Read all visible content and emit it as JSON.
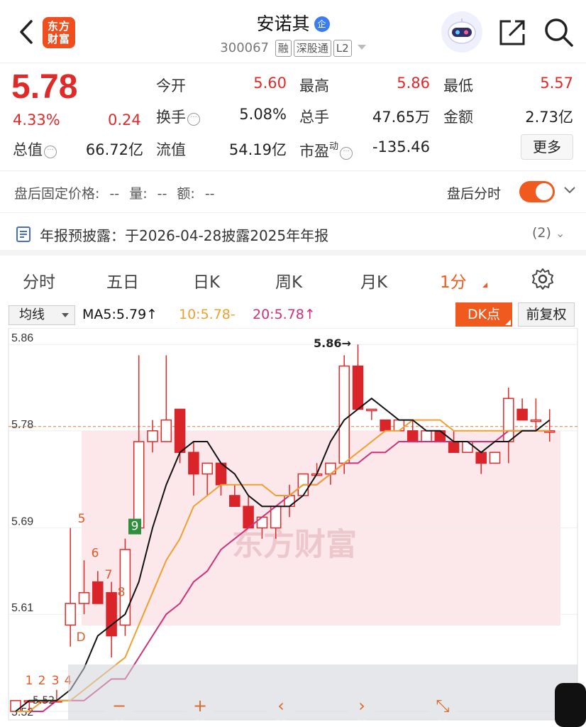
{
  "header": {
    "back_icon": "chevron-left-icon",
    "logo_text": "东方\n财富",
    "stock_name": "安诺其",
    "verified_badge": "企",
    "code": "300067",
    "tags": [
      "融",
      "深股通",
      "L2"
    ],
    "robot_icon": "robot-icon",
    "share_icon": "share-icon",
    "search_icon": "search-icon"
  },
  "quote": {
    "price": "5.78",
    "change_pct": "4.33%",
    "change": "0.24",
    "rows": [
      [
        {
          "label": "今开",
          "value": "5.60",
          "color": "red"
        },
        {
          "label": "最高",
          "value": "5.86",
          "color": "red"
        },
        {
          "label": "最低",
          "value": "5.57",
          "color": "red"
        }
      ],
      [
        {
          "label": "换手",
          "value": "5.08%",
          "color": "dark"
        },
        {
          "label": "总手",
          "value": "47.65万",
          "color": "dark"
        },
        {
          "label": "金额",
          "value": "2.73亿",
          "color": "dark"
        }
      ],
      [
        {
          "label": "流值",
          "value": "54.19亿",
          "color": "dark"
        },
        {
          "label": "市盈",
          "value": "-135.46",
          "color": "dark"
        }
      ]
    ],
    "total_value_label": "总值",
    "total_value": "66.72亿",
    "pe_superscript": "动",
    "more_label": "更多"
  },
  "after_hours": {
    "text": "盘后固定价格: -- 量: -- 额: --",
    "right_label": "盘后分时",
    "toggle_on": true
  },
  "notice": {
    "text": "年报预披露：于2026-04-28披露2025年年报",
    "count": "(2)"
  },
  "tabs": [
    "分时",
    "五日",
    "日K",
    "周K",
    "月K",
    "1分"
  ],
  "active_tab": "1分",
  "indicators": {
    "select_label": "均线",
    "ma5": "MA5:5.79↑",
    "ma10": "10:5.78-",
    "ma20": "20:5.78↑",
    "dk_label": "DK点",
    "adjust_label": "前复权",
    "colors": {
      "ma5": "#111111",
      "ma10": "#f0a030",
      "ma20": "#d0307a",
      "up": "#e02a2a",
      "down": "#d9252a",
      "accent": "#f15a1f"
    }
  },
  "chart_data": {
    "type": "candlestick",
    "y_ticks": [
      "5.86",
      "5.78",
      "5.69",
      "5.61",
      "5.52"
    ],
    "ylim": [
      5.52,
      5.87
    ],
    "high_annotation": "5.86→",
    "low_annotation": "5.52",
    "watermark": "东方财富",
    "signal_labels": [
      "1",
      "2",
      "3",
      "4",
      "5",
      "6",
      "7",
      "8",
      "9",
      "D"
    ],
    "last_price": 5.78,
    "candles": [
      {
        "o": 5.52,
        "h": 5.53,
        "l": 5.52,
        "c": 5.53
      },
      {
        "o": 5.53,
        "h": 5.53,
        "l": 5.52,
        "c": 5.53
      },
      {
        "o": 5.53,
        "h": 5.53,
        "l": 5.53,
        "c": 5.53
      },
      {
        "o": 5.53,
        "h": 5.54,
        "l": 5.53,
        "c": 5.53
      },
      {
        "o": 5.6,
        "h": 5.69,
        "l": 5.58,
        "c": 5.62
      },
      {
        "o": 5.62,
        "h": 5.66,
        "l": 5.61,
        "c": 5.63
      },
      {
        "o": 5.64,
        "h": 5.65,
        "l": 5.62,
        "c": 5.62
      },
      {
        "o": 5.63,
        "h": 5.64,
        "l": 5.57,
        "c": 5.59
      },
      {
        "o": 5.6,
        "h": 5.68,
        "l": 5.59,
        "c": 5.67
      },
      {
        "o": 5.69,
        "h": 5.85,
        "l": 5.69,
        "c": 5.77
      },
      {
        "o": 5.77,
        "h": 5.79,
        "l": 5.76,
        "c": 5.78
      },
      {
        "o": 5.77,
        "h": 5.85,
        "l": 5.77,
        "c": 5.79
      },
      {
        "o": 5.8,
        "h": 5.8,
        "l": 5.75,
        "c": 5.76
      },
      {
        "o": 5.76,
        "h": 5.77,
        "l": 5.72,
        "c": 5.74
      },
      {
        "o": 5.74,
        "h": 5.75,
        "l": 5.72,
        "c": 5.75
      },
      {
        "o": 5.75,
        "h": 5.75,
        "l": 5.72,
        "c": 5.73
      },
      {
        "o": 5.72,
        "h": 5.73,
        "l": 5.71,
        "c": 5.71
      },
      {
        "o": 5.71,
        "h": 5.72,
        "l": 5.69,
        "c": 5.69
      },
      {
        "o": 5.69,
        "h": 5.7,
        "l": 5.68,
        "c": 5.7
      },
      {
        "o": 5.69,
        "h": 5.71,
        "l": 5.68,
        "c": 5.71
      },
      {
        "o": 5.71,
        "h": 5.73,
        "l": 5.7,
        "c": 5.72
      },
      {
        "o": 5.72,
        "h": 5.74,
        "l": 5.72,
        "c": 5.74
      },
      {
        "o": 5.74,
        "h": 5.75,
        "l": 5.74,
        "c": 5.74
      },
      {
        "o": 5.74,
        "h": 5.75,
        "l": 5.73,
        "c": 5.75
      },
      {
        "o": 5.75,
        "h": 5.85,
        "l": 5.74,
        "c": 5.84
      },
      {
        "o": 5.84,
        "h": 5.86,
        "l": 5.8,
        "c": 5.8
      },
      {
        "o": 5.8,
        "h": 5.8,
        "l": 5.79,
        "c": 5.8
      },
      {
        "o": 5.79,
        "h": 5.79,
        "l": 5.78,
        "c": 5.78
      },
      {
        "o": 5.78,
        "h": 5.79,
        "l": 5.78,
        "c": 5.79
      },
      {
        "o": 5.78,
        "h": 5.79,
        "l": 5.77,
        "c": 5.77
      },
      {
        "o": 5.77,
        "h": 5.78,
        "l": 5.77,
        "c": 5.78
      },
      {
        "o": 5.78,
        "h": 5.78,
        "l": 5.77,
        "c": 5.77
      },
      {
        "o": 5.77,
        "h": 5.78,
        "l": 5.76,
        "c": 5.76
      },
      {
        "o": 5.76,
        "h": 5.77,
        "l": 5.76,
        "c": 5.77
      },
      {
        "o": 5.76,
        "h": 5.76,
        "l": 5.74,
        "c": 5.75
      },
      {
        "o": 5.75,
        "h": 5.76,
        "l": 5.75,
        "c": 5.76
      },
      {
        "o": 5.77,
        "h": 5.82,
        "l": 5.75,
        "c": 5.81
      },
      {
        "o": 5.8,
        "h": 5.81,
        "l": 5.79,
        "c": 5.79
      },
      {
        "o": 5.79,
        "h": 5.81,
        "l": 5.78,
        "c": 5.79
      },
      {
        "o": 5.78,
        "h": 5.8,
        "l": 5.77,
        "c": 5.78
      }
    ],
    "ma5": [
      5.52,
      5.53,
      5.53,
      5.53,
      5.54,
      5.56,
      5.59,
      5.6,
      5.61,
      5.64,
      5.69,
      5.73,
      5.76,
      5.77,
      5.77,
      5.75,
      5.74,
      5.72,
      5.71,
      5.71,
      5.71,
      5.72,
      5.74,
      5.77,
      5.79,
      5.8,
      5.81,
      5.8,
      5.79,
      5.79,
      5.78,
      5.78,
      5.77,
      5.77,
      5.76,
      5.77,
      5.77,
      5.78,
      5.78,
      5.79
    ],
    "ma10": [
      5.52,
      5.52,
      5.53,
      5.53,
      5.53,
      5.54,
      5.55,
      5.56,
      5.57,
      5.6,
      5.63,
      5.66,
      5.68,
      5.71,
      5.72,
      5.73,
      5.73,
      5.73,
      5.73,
      5.72,
      5.72,
      5.73,
      5.73,
      5.74,
      5.75,
      5.76,
      5.77,
      5.78,
      5.78,
      5.79,
      5.79,
      5.79,
      5.78,
      5.78,
      5.78,
      5.78,
      5.78,
      5.78,
      5.78,
      5.78
    ],
    "ma20": [
      5.52,
      5.52,
      5.52,
      5.53,
      5.53,
      5.53,
      5.54,
      5.55,
      5.55,
      5.57,
      5.59,
      5.61,
      5.62,
      5.64,
      5.65,
      5.67,
      5.68,
      5.69,
      5.7,
      5.71,
      5.72,
      5.73,
      5.73,
      5.74,
      5.75,
      5.75,
      5.76,
      5.76,
      5.77,
      5.77,
      5.77,
      5.77,
      5.77,
      5.77,
      5.77,
      5.77,
      5.78,
      5.78,
      5.78,
      5.78
    ]
  },
  "chart_controls": [
    "−",
    "+",
    "‹",
    "›",
    "⤡"
  ]
}
